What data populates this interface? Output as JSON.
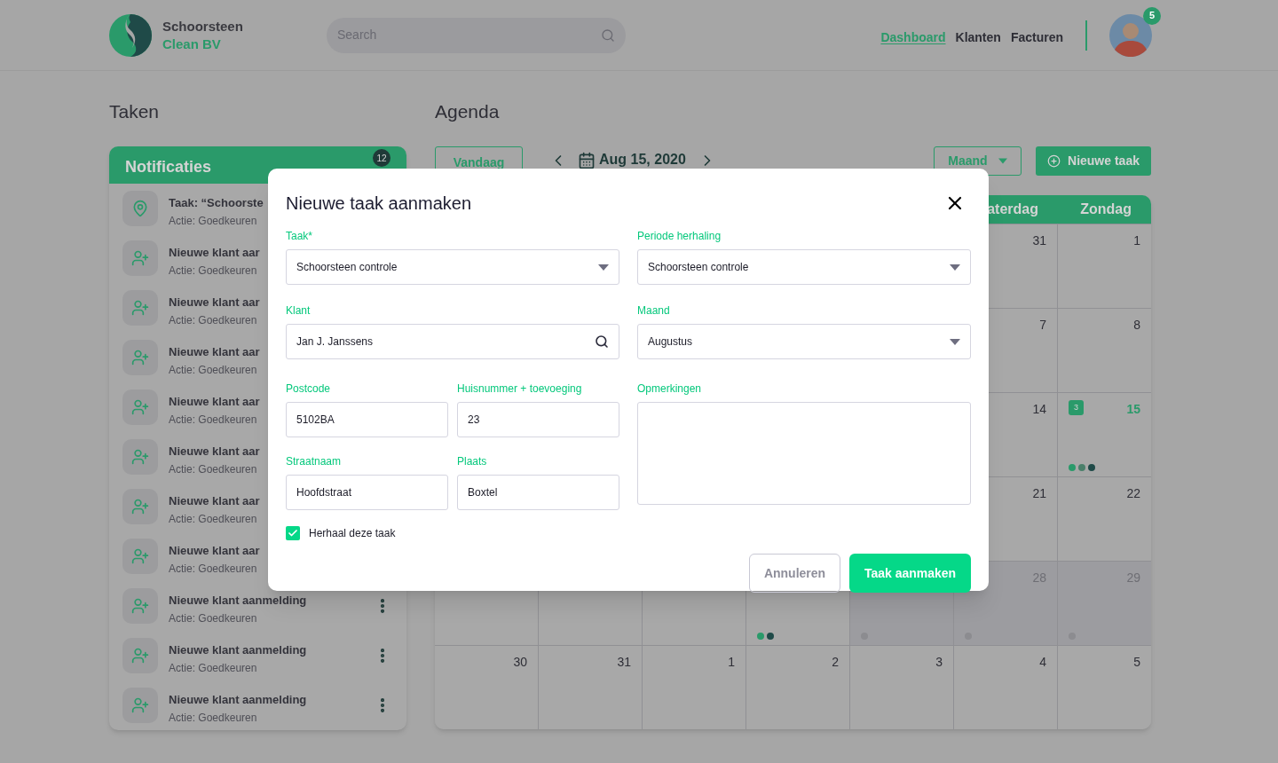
{
  "header": {
    "brand": {
      "line1": "Schoorsteen",
      "line2": "Clean BV"
    },
    "search": {
      "placeholder": "Search"
    },
    "nav": [
      {
        "label": "Dashboard",
        "selected": true
      },
      {
        "label": "Klanten",
        "selected": false
      },
      {
        "label": "Facturen",
        "selected": false
      }
    ],
    "notification_count": "5"
  },
  "tasks": {
    "title": "Taken",
    "panel": {
      "title": "Notificaties",
      "count": "12",
      "items": [
        {
          "kind": "task",
          "title": "Taak: “Schoorste",
          "action": "Actie: Goedkeuren"
        },
        {
          "kind": "client",
          "title": "Nieuwe klant aar",
          "action": "Actie: Goedkeuren"
        },
        {
          "kind": "client",
          "title": "Nieuwe klant aar",
          "action": "Actie: Goedkeuren"
        },
        {
          "kind": "client",
          "title": "Nieuwe klant aar",
          "action": "Actie: Goedkeuren"
        },
        {
          "kind": "client",
          "title": "Nieuwe klant aar",
          "action": "Actie: Goedkeuren"
        },
        {
          "kind": "client",
          "title": "Nieuwe klant aar",
          "action": "Actie: Goedkeuren"
        },
        {
          "kind": "client",
          "title": "Nieuwe klant aar",
          "action": "Actie: Goedkeuren"
        },
        {
          "kind": "client",
          "title": "Nieuwe klant aar",
          "action": "Actie: Goedkeuren"
        },
        {
          "kind": "client",
          "title": "Nieuwe klant aanmelding",
          "action": "Actie: Goedkeuren",
          "has_menu": true
        },
        {
          "kind": "client",
          "title": "Nieuwe klant aanmelding",
          "action": "Actie: Goedkeuren",
          "has_menu": true
        },
        {
          "kind": "client",
          "title": "Nieuwe klant aanmelding",
          "action": "Actie: Goedkeuren",
          "has_menu": true
        }
      ]
    }
  },
  "agenda": {
    "title": "Agenda",
    "today_button": "Vandaag",
    "date": "Aug 15, 2020",
    "view_select": "Maand",
    "new_button": "Nieuwe taak",
    "calendar": {
      "weekdays": [
        {
          "label": "aterdag"
        },
        {
          "label": "Zondag"
        }
      ],
      "weeks": [
        [
          {
            "day": "31",
            "disabled": false,
            "selected": false
          },
          {
            "day": "1",
            "disabled": false,
            "selected": false
          }
        ],
        [
          {
            "day": "7",
            "disabled": false,
            "selected": false
          },
          {
            "day": "8",
            "disabled": false,
            "selected": false
          }
        ],
        [
          {
            "day": "14",
            "disabled": false,
            "selected": false
          },
          {
            "day": "15",
            "disabled": false,
            "selected": true,
            "badge": "3",
            "dots": [
              {
                "color": "#2a9a6a"
              },
              {
                "color": "#4a7f6a"
              },
              {
                "color": "#1f4a48"
              }
            ]
          }
        ],
        [
          {
            "day": "21",
            "disabled": false,
            "selected": false
          },
          {
            "day": "22",
            "disabled": false,
            "selected": false
          }
        ],
        [
          {
            "disabled": false
          },
          {
            "disabled": false
          },
          {
            "disabled": false
          },
          {
            "disabled": false,
            "dots": [
              {
                "color": "#2a9a6a"
              },
              {
                "color": "#1f4a48"
              }
            ]
          },
          {
            "disabled": true,
            "dots": [
              {
                "color": "#8c8c90"
              }
            ]
          },
          {
            "day": "28",
            "disabled": true,
            "selected": false,
            "dots": [
              {
                "color": "#8c8c90"
              }
            ]
          },
          {
            "day": "29",
            "disabled": true,
            "selected": false,
            "dots": [
              {
                "color": "#8c8c90"
              }
            ]
          }
        ],
        [
          {
            "day": "30",
            "disabled": false,
            "selected": false
          },
          {
            "day": "31",
            "disabled": false,
            "selected": false
          },
          {
            "day": "1",
            "disabled": false,
            "selected": false
          },
          {
            "day": "2",
            "disabled": false,
            "selected": false
          },
          {
            "day": "3",
            "disabled": false,
            "selected": false
          },
          {
            "day": "4",
            "disabled": false,
            "selected": false
          },
          {
            "day": "5",
            "disabled": false,
            "selected": false
          }
        ]
      ]
    }
  },
  "modal": {
    "title": "Nieuwe taak aanmaken",
    "fields": {
      "task": {
        "label": "Taak*",
        "value": "Schoorsteen controle",
        "kind": "select"
      },
      "client": {
        "label": "Klant",
        "value": "Jan J. Janssens",
        "kind": "search"
      },
      "postcode": {
        "label": "Postcode",
        "value": "5102BA"
      },
      "house_number": {
        "label": "Huisnummer + toevoeging",
        "value": "23"
      },
      "street": {
        "label": "Straatnaam",
        "value": "Hoofdstraat"
      },
      "city": {
        "label": "Plaats",
        "value": "Boxtel"
      },
      "repeat_period": {
        "label": "Periode herhaling",
        "value": "Schoorsteen controle",
        "kind": "select"
      },
      "month": {
        "label": "Maand",
        "value": "Augustus",
        "kind": "select"
      },
      "remarks": {
        "label": "Opmerkingen",
        "kind": "textarea"
      }
    },
    "repeat": {
      "label": "Herhaal deze taak",
      "checked": true
    },
    "cancel_button": "Annuleren",
    "submit_button": "Taak aanmaken"
  }
}
